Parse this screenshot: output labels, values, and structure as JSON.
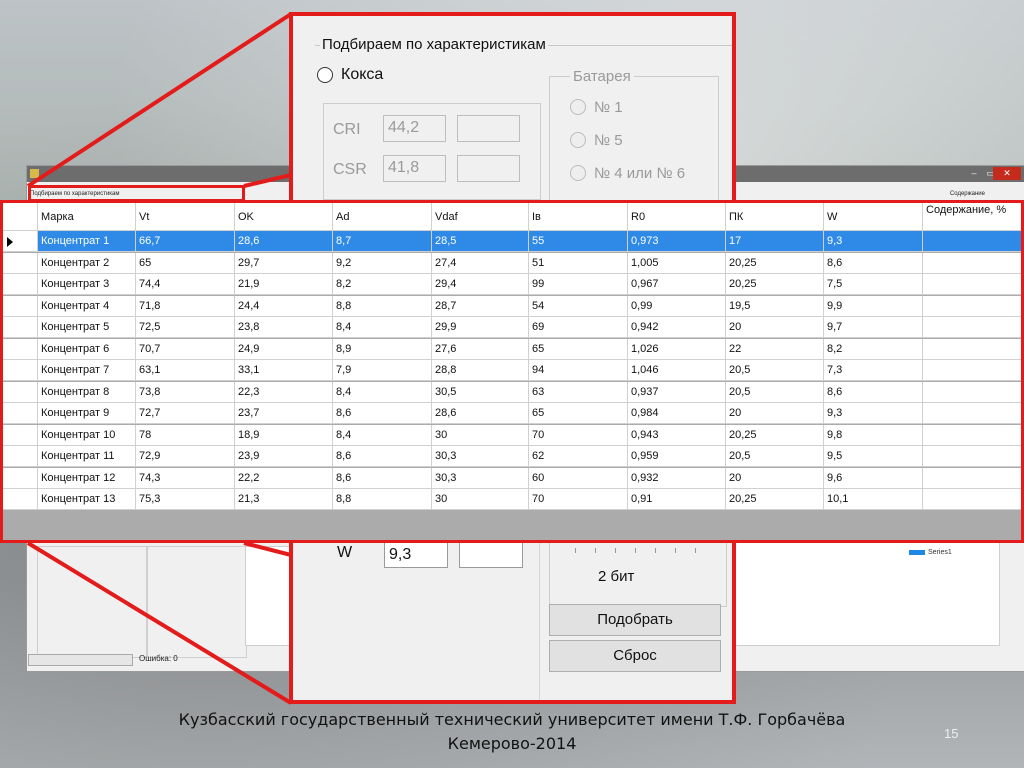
{
  "background_window": {
    "groupbox_label": "Подбираем по характеристикам",
    "content_label": "Содержание",
    "minimize": "–",
    "restore": "▭",
    "close": "✕",
    "status_error": "Ошибка:  0",
    "legend": "Series1"
  },
  "dialog": {
    "groupbox_title": "Подбираем по характеристикам",
    "coke_label": "Кокса",
    "cri_label": "CRI",
    "cri_value": "44,2",
    "csr_label": "CSR",
    "csr_value": "41,8",
    "battery_title": "Батарея",
    "battery_options": [
      "№ 1",
      "№ 5",
      "№ 4 или № 6"
    ],
    "w_label": "W",
    "w_value": "9,3",
    "bit_label": "2 бит",
    "pick_button": "Подобрать",
    "reset_button": "Сброс"
  },
  "table": {
    "columns": [
      "Марка",
      "Vt",
      "OK",
      "Ad",
      "Vdaf",
      "Iв",
      "R0",
      "ПК",
      "W",
      "Содержание, %"
    ],
    "rows": [
      [
        "Концентрат 1",
        "66,7",
        "28,6",
        "8,7",
        "28,5",
        "55",
        "0,973",
        "17",
        "9,3",
        ""
      ],
      [
        "Концентрат 2",
        "65",
        "29,7",
        "9,2",
        "27,4",
        "51",
        "1,005",
        "20,25",
        "8,6",
        ""
      ],
      [
        "Концентрат 3",
        "74,4",
        "21,9",
        "8,2",
        "29,4",
        "99",
        "0,967",
        "20,25",
        "7,5",
        ""
      ],
      [
        "Концентрат 4",
        "71,8",
        "24,4",
        "8,8",
        "28,7",
        "54",
        "0,99",
        "19,5",
        "9,9",
        ""
      ],
      [
        "Концентрат 5",
        "72,5",
        "23,8",
        "8,4",
        "29,9",
        "69",
        "0,942",
        "20",
        "9,7",
        ""
      ],
      [
        "Концентрат 6",
        "70,7",
        "24,9",
        "8,9",
        "27,6",
        "65",
        "1,026",
        "22",
        "8,2",
        ""
      ],
      [
        "Концентрат 7",
        "63,1",
        "33,1",
        "7,9",
        "28,8",
        "94",
        "1,046",
        "20,5",
        "7,3",
        ""
      ],
      [
        "Концентрат 8",
        "73,8",
        "22,3",
        "8,4",
        "30,5",
        "63",
        "0,937",
        "20,5",
        "8,6",
        ""
      ],
      [
        "Концентрат 9",
        "72,7",
        "23,7",
        "8,6",
        "28,6",
        "65",
        "0,984",
        "20",
        "9,3",
        ""
      ],
      [
        "Концентрат 10",
        "78",
        "18,9",
        "8,4",
        "30",
        "70",
        "0,943",
        "20,25",
        "9,8",
        ""
      ],
      [
        "Концентрат 11",
        "72,9",
        "23,9",
        "8,6",
        "30,3",
        "62",
        "0,959",
        "20,5",
        "9,5",
        ""
      ],
      [
        "Концентрат 12",
        "74,3",
        "22,2",
        "8,6",
        "30,3",
        "60",
        "0,932",
        "20",
        "9,6",
        ""
      ],
      [
        "Концентрат 13",
        "75,3",
        "21,3",
        "8,8",
        "30",
        "70",
        "0,91",
        "20,25",
        "10,1",
        ""
      ]
    ],
    "selected_row": 0,
    "selection_color": "#2e8ae6"
  },
  "footer": {
    "line1": "Кузбасский государственный технический университет имени Т.Ф. Горбачёва",
    "line2": "Кемерово-2014",
    "page_number": "15"
  },
  "colors": {
    "highlight_red": "#e31b1b"
  }
}
